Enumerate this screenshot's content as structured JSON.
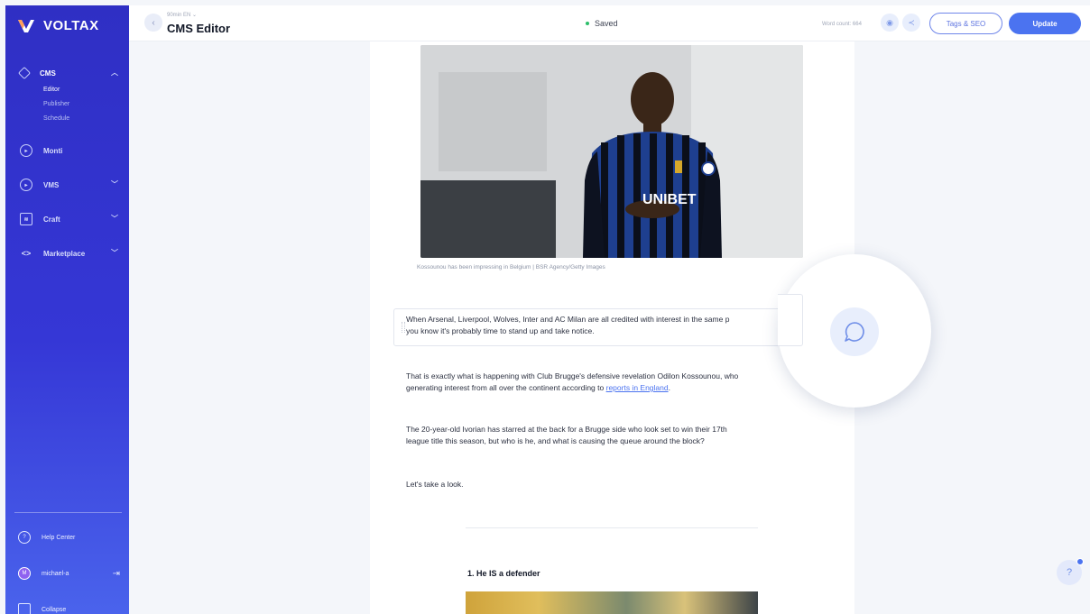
{
  "sidebar": {
    "brand": "VOLTAX",
    "nav": [
      {
        "label": "CMS",
        "icon": "feather-icon"
      },
      {
        "label": "Monti",
        "icon": "play-circle-icon"
      },
      {
        "label": "VMS",
        "icon": "play-circle-icon"
      },
      {
        "label": "Craft",
        "icon": "layers-icon"
      },
      {
        "label": "Marketplace",
        "icon": "code-icon"
      }
    ],
    "cms_sub": [
      "Editor",
      "Publisher",
      "Schedule"
    ],
    "help_center": "Help Center",
    "user": {
      "initial": "M",
      "name": "michael-a"
    },
    "collapse": "Collapse"
  },
  "topbar": {
    "site_selector": "90min EN",
    "title": "CMS Editor",
    "status": "Saved",
    "word_count": "Word count: 664",
    "tags_seo": "Tags & SEO",
    "update": "Update"
  },
  "article": {
    "caption": "Kossounou has been impressing in Belgium | BSR Agency/Getty Images",
    "p1": "When Arsenal, Liverpool, Wolves, Inter and AC Milan are all credited with interest in the same p",
    "p1_cont": "you know it's probably time to stand up and take notice.",
    "p2_a": "That is exactly what is happening with Club Brugge's defensive revelation Odilon Kossounou, who",
    "p2_b": "generating interest from all over the continent according to ",
    "p2_link": "reports in England",
    "p2_c": ".",
    "p3_a": "The 20-year-old Ivorian has starred at the back for a Brugge side who look set to win their 17th",
    "p3_b": "league title this season, but who is he, and what is causing the queue around the block?",
    "p4": "Let's take a look.",
    "heading1": "1. He IS a defender",
    "jersey_text": "UNIBET"
  },
  "colors": {
    "sidebar_top": "#2f2fc4",
    "sidebar_bottom": "#4a63ec",
    "accent": "#4b73f0",
    "saved_dot": "#2cbe6a"
  }
}
